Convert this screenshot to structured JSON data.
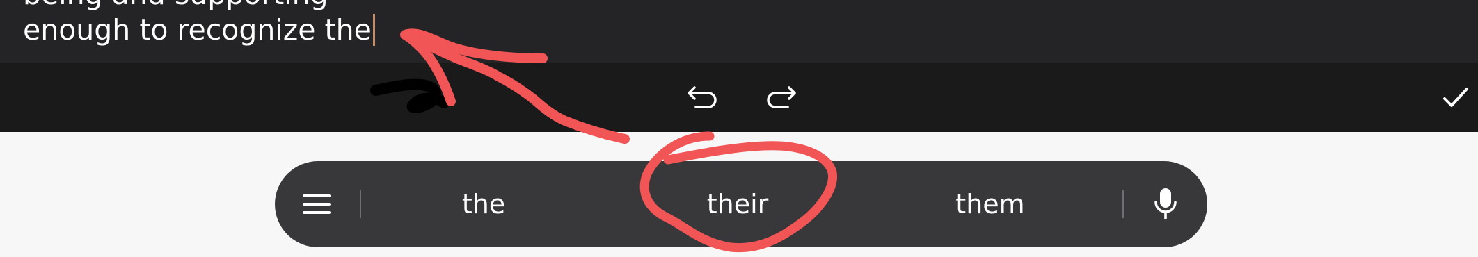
{
  "editor": {
    "previous_line": "being and supporting",
    "current_line": "enough to recognize the"
  },
  "toolbar": {
    "undo_icon": "undo-icon",
    "redo_icon": "redo-icon",
    "done_icon": "check-icon"
  },
  "suggestion_bar": {
    "menu_icon": "menu-icon",
    "suggestions": [
      "the",
      "their",
      "them"
    ],
    "mic_icon": "microphone-icon"
  },
  "annotation_color": "#f25555"
}
